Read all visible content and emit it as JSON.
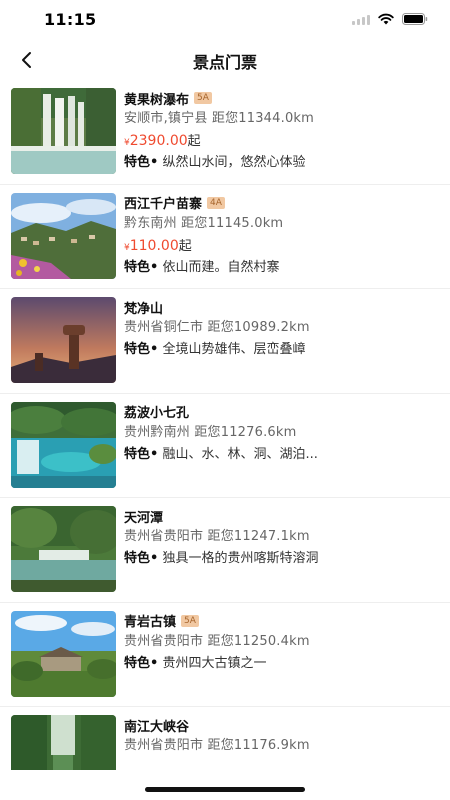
{
  "status_bar": {
    "time": "11:15"
  },
  "nav": {
    "title": "景点门票"
  },
  "feature_label": "特色•",
  "price_unit": "起",
  "currency_symbol": "¥",
  "items": [
    {
      "name": "黄果树瀑布",
      "level": "5A",
      "location": "安顺市,镇宁县  距您11344.0km",
      "price": "2390.00",
      "feature": " 纵然山水间，悠然心体验"
    },
    {
      "name": "西江千户苗寨",
      "level": "4A",
      "location": "黔东南州  距您11145.0km",
      "price": "110.00",
      "feature": " 依山而建。自然村寨"
    },
    {
      "name": "梵净山",
      "level": "",
      "location": "贵州省铜仁市  距您10989.2km",
      "price": "",
      "feature": " 全境山势雄伟、层峦叠嶂"
    },
    {
      "name": "荔波小七孔",
      "level": "",
      "location": "贵州黔南州  距您11276.6km",
      "price": "",
      "feature": " 融山、水、林、洞、湖泊..."
    },
    {
      "name": "天河潭",
      "level": "",
      "location": "贵州省贵阳市  距您11247.1km",
      "price": "",
      "feature": " 独具一格的贵州喀斯特溶洞"
    },
    {
      "name": "青岩古镇",
      "level": "5A",
      "location": "贵州省贵阳市  距您11250.4km",
      "price": "",
      "feature": " 贵州四大古镇之一"
    },
    {
      "name": "南江大峡谷",
      "level": "",
      "location": "贵州省贵阳市  距您11176.9km",
      "price": "",
      "feature": ""
    }
  ]
}
